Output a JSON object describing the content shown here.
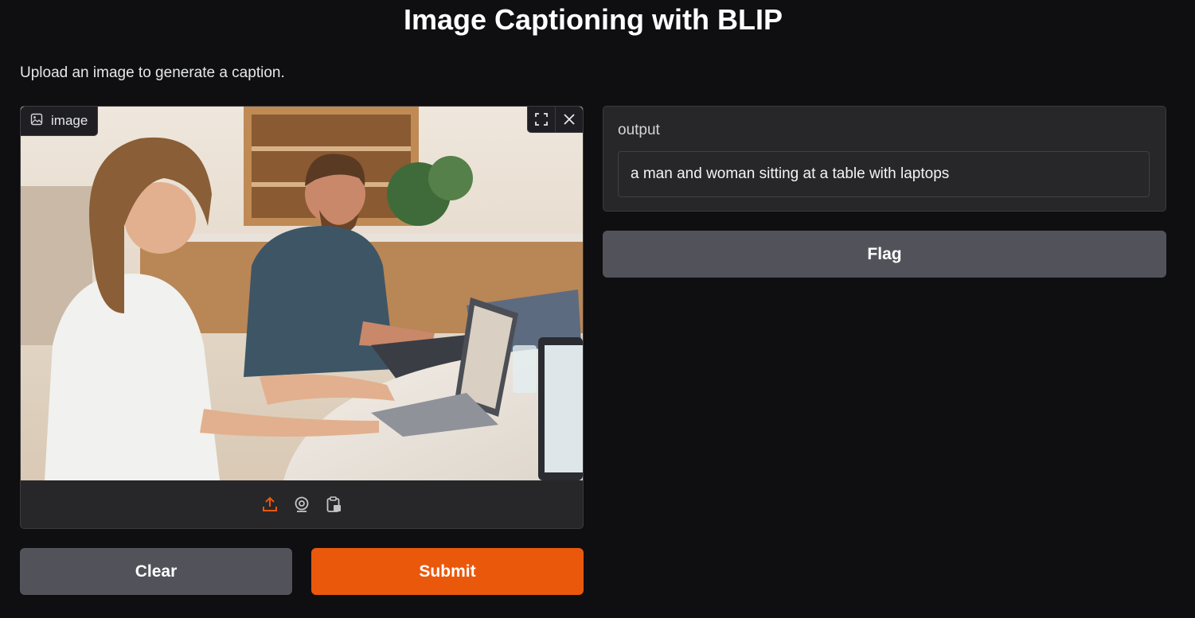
{
  "header": {
    "title": "Image Captioning with BLIP",
    "description": "Upload an image to generate a caption."
  },
  "image_input": {
    "label": "image",
    "label_icon": "image-icon",
    "actions": [
      "fullscreen-icon",
      "close-icon"
    ],
    "sources": [
      "upload-icon",
      "webcam-icon",
      "clipboard-icon"
    ],
    "active_source": "upload-icon",
    "preview_alt": "photo of a woman and a man working on laptops at a cafe table"
  },
  "buttons": {
    "clear": "Clear",
    "submit": "Submit",
    "flag": "Flag"
  },
  "output": {
    "label": "output",
    "value": "a man and woman sitting at a table with laptops"
  },
  "colors": {
    "background": "#0f0e11",
    "panel": "#27272a",
    "primary": "#ea580c",
    "secondary": "#52525b"
  }
}
